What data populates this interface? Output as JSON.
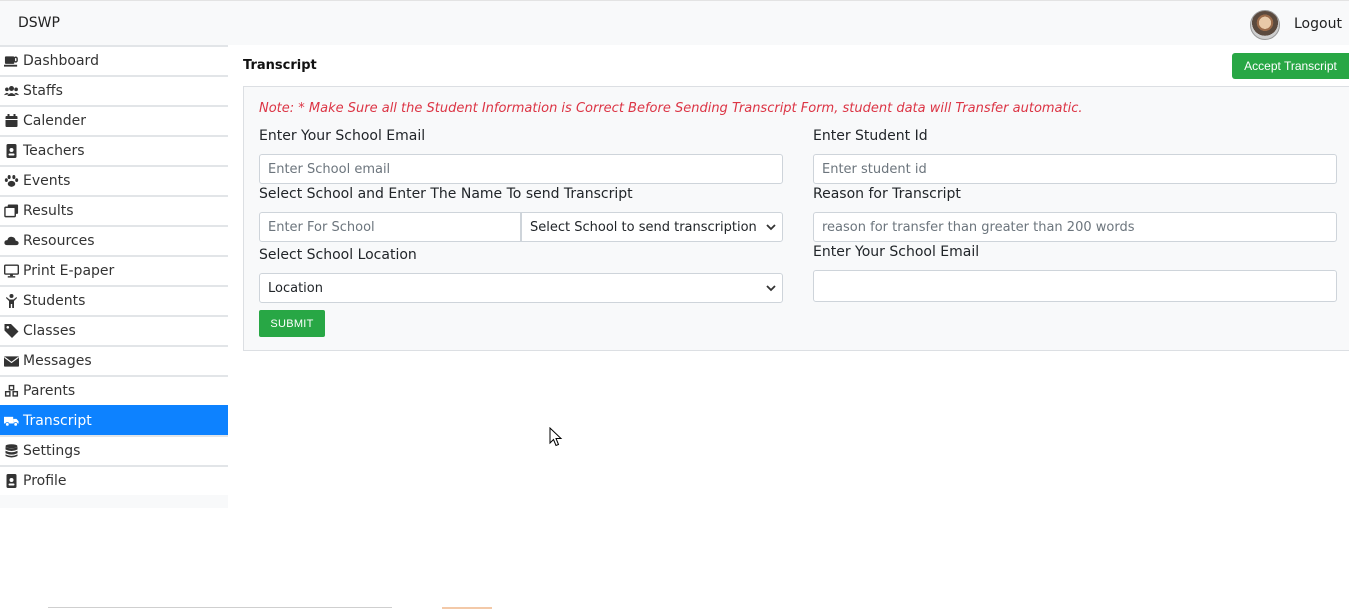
{
  "navbar": {
    "brand": "DSWP",
    "logout_label": "Logout",
    "avatar_icon": "user-avatar"
  },
  "sidebar": {
    "items": [
      {
        "label": "Dashboard",
        "icon": "coffee-icon"
      },
      {
        "label": "Staffs",
        "icon": "users-icon"
      },
      {
        "label": "Calender",
        "icon": "calendar-icon"
      },
      {
        "label": "Teachers",
        "icon": "id-badge-icon"
      },
      {
        "label": "Events",
        "icon": "paw-icon"
      },
      {
        "label": "Results",
        "icon": "clone-icon"
      },
      {
        "label": "Resources",
        "icon": "cloud-icon"
      },
      {
        "label": "Print E-paper",
        "icon": "desktop-icon"
      },
      {
        "label": "Students",
        "icon": "child-icon"
      },
      {
        "label": "Classes",
        "icon": "tag-icon"
      },
      {
        "label": "Messages",
        "icon": "envelope-icon"
      },
      {
        "label": "Parents",
        "icon": "cubes-icon"
      },
      {
        "label": "Transcript",
        "icon": "truck-icon",
        "active": true
      },
      {
        "label": "Settings",
        "icon": "database-icon"
      },
      {
        "label": "Profile",
        "icon": "id-badge-icon"
      }
    ],
    "active_color": "#0d82ff"
  },
  "main": {
    "title": "Transcript",
    "accept_button": "Accept Transcript",
    "note": "Note: * Make Sure all the Student Information is Correct Before Sending Transcript Form, student data will Transfer automatic.",
    "form": {
      "school_email_label": "Enter Your School Email",
      "school_email_placeholder": "Enter School email",
      "student_id_label": "Enter Student Id",
      "student_id_placeholder": "Enter student id",
      "select_school_label": "Select School and Enter The Name To send Transcript",
      "school_name_placeholder": "Enter For School",
      "school_select_value": "Select School to send transcription",
      "reason_label": "Reason for Transcript",
      "reason_placeholder": "reason for transfer than greater than 200 words",
      "location_label": "Select School Location",
      "location_value": "Location",
      "your_email_label": "Enter Your School Email",
      "your_email_value": "",
      "submit_label": "SUBMIT"
    },
    "colors": {
      "success": "#28a745",
      "danger": "#dc3545"
    }
  }
}
